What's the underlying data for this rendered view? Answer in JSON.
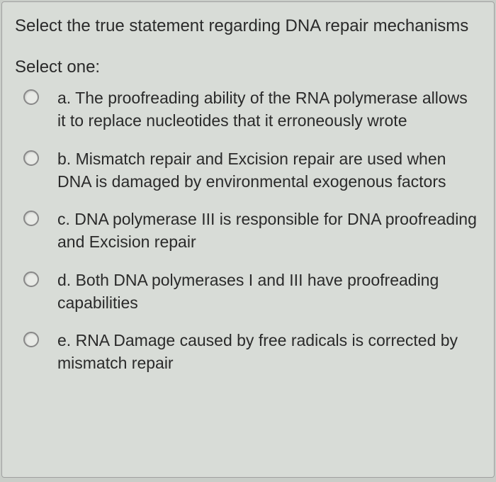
{
  "question": {
    "prompt": "Select the true statement regarding DNA repair mechanisms",
    "select_label": "Select one:",
    "options": [
      {
        "letter": "a.",
        "text": "The proofreading ability of the RNA polymerase allows it to replace nucleotides that it erroneously wrote"
      },
      {
        "letter": "b.",
        "text": "Mismatch repair and Excision repair are used when DNA is damaged by environmental exogenous factors"
      },
      {
        "letter": "c.",
        "text": "DNA polymerase III is responsible for DNA proofreading and Excision repair"
      },
      {
        "letter": "d.",
        "text": "Both DNA polymerases I and III have proofreading capabilities"
      },
      {
        "letter": "e.",
        "text": "RNA Damage caused by free radicals is corrected by mismatch repair"
      }
    ]
  }
}
